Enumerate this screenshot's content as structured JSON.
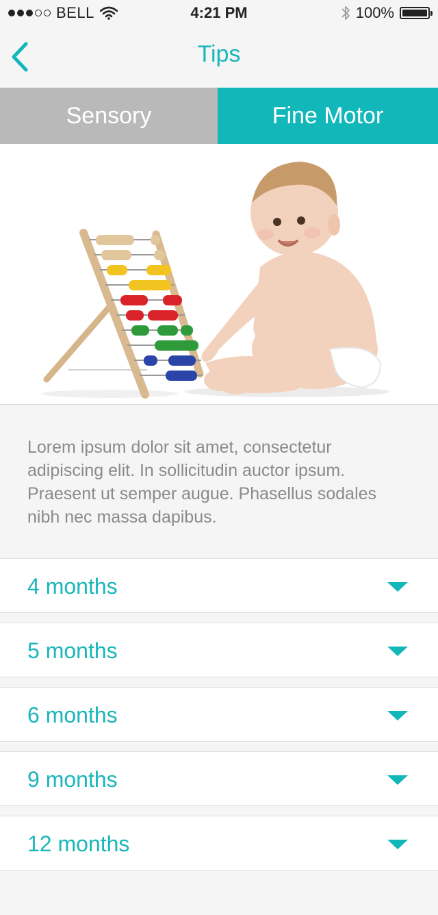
{
  "status_bar": {
    "carrier": "BELL",
    "time": "4:21 PM",
    "battery": "100%",
    "battery_level": 1.0,
    "signal_bars_filled": 3,
    "signal_bars_total": 5
  },
  "nav": {
    "title": "Tips",
    "back_icon": "chevron-left-icon"
  },
  "tabs": [
    {
      "label": "Sensory",
      "active": false
    },
    {
      "label": "Fine Motor",
      "active": true
    }
  ],
  "description": "Lorem ipsum dolor sit amet, consectetur adipiscing elit. In sollicitudin auctor ipsum. Praesent ut semper augue. Phasellus sodales nibh nec massa dapibus.",
  "age_sections": [
    {
      "label": "4 months"
    },
    {
      "label": "5 months"
    },
    {
      "label": "6 months"
    },
    {
      "label": "9 months"
    },
    {
      "label": "12 months"
    }
  ],
  "colors": {
    "accent": "#12b7ba",
    "accent_text": "#1ab6b9",
    "inactive_tab": "#b9b9b9",
    "background": "#f5f5f5"
  }
}
